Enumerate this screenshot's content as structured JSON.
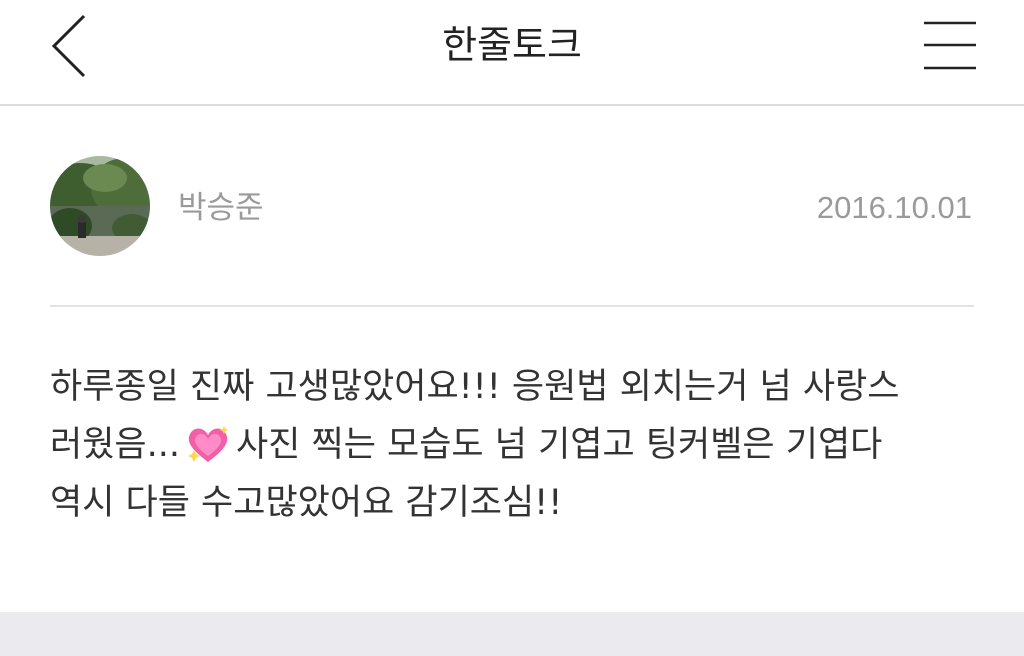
{
  "header": {
    "title": "한줄토크",
    "back_icon": "chevron-left-icon",
    "menu_icon": "hamburger-menu-icon"
  },
  "post": {
    "author": "박승준",
    "date": "2016.10.01",
    "avatar": "profile-photo",
    "body_lines": {
      "line1": "하루종일 진짜 고생많았어요!!! 응원법 외치는거 넘 사랑스",
      "line2_before": "러웠음...",
      "line2_after": "사진 찍는 모습도 넘 기엽고 팅커벨은 기엽다",
      "line3": "역시 다들 수고많았어요 감기조심!!"
    },
    "emoji": "sparkling-heart-icon"
  },
  "colors": {
    "title": "#222222",
    "meta": "#9a9a9a",
    "body": "#333333",
    "divider": "#e2e2e4",
    "footer_band": "#ebebef",
    "heart_pink": "#f25fa8"
  }
}
